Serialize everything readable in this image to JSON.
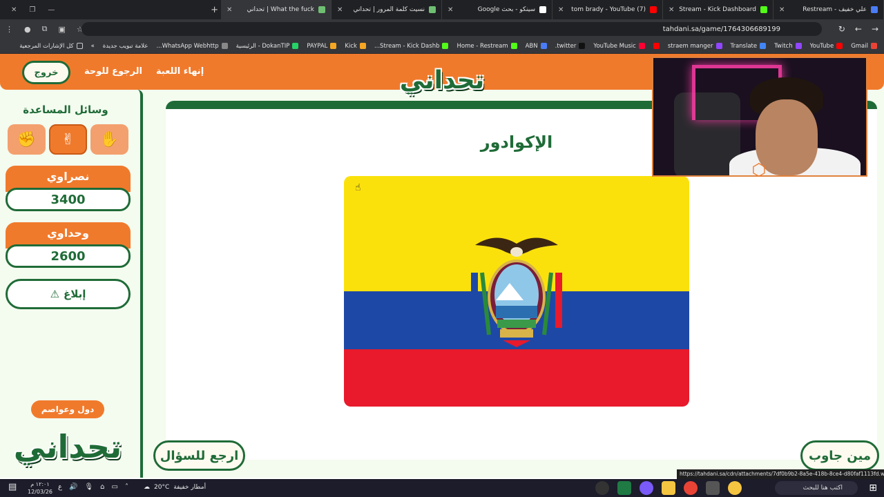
{
  "browser": {
    "tabs": [
      {
        "title": "علي خفيف - Restream",
        "color": "#4a7cf7"
      },
      {
        "title": "Stream - Kick Dashboard",
        "color": "#53fc18"
      },
      {
        "title": "(7) tom brady - YouTube",
        "color": "#ff0000"
      },
      {
        "title": "سينكو - بحث Google",
        "color": "#ffffff"
      },
      {
        "title": "نسيت كلمة المرور | تحداني",
        "color": "#6fbf73"
      },
      {
        "title": "What the fuck | تحداني",
        "color": "#6fbf73",
        "active": true
      }
    ],
    "url": "tahdani.sa/game/1764306689199",
    "bookmarks": [
      {
        "label": "Gmail",
        "color": "#ea4335"
      },
      {
        "label": "YouTube",
        "color": "#ff0000"
      },
      {
        "label": "Twitch",
        "color": "#9146ff"
      },
      {
        "label": "Translate",
        "color": "#4285f4"
      },
      {
        "label": "straem manger",
        "color": "#9146ff"
      },
      {
        "label": "",
        "color": "#ff0000"
      },
      {
        "label": "YouTube Music",
        "color": "#ff0033"
      },
      {
        "label": "twitter.",
        "color": "#111111"
      },
      {
        "label": "ABN",
        "color": "#4a7cf7"
      },
      {
        "label": "Home - Restream",
        "color": "#53fc18"
      },
      {
        "label": "Stream - Kick Dashb...",
        "color": "#53fc18"
      },
      {
        "label": "Kick",
        "color": "#f5a623"
      },
      {
        "label": "PAYPAL",
        "color": "#f5a623"
      },
      {
        "label": "DokanTIP - الرئيسية",
        "color": "#25d366"
      },
      {
        "label": "WhatsApp Webhttp...",
        "color": "#888888"
      },
      {
        "label": "علامة تبويب جديدة",
        "color": "#35363a"
      }
    ],
    "bookmarks_folder": "كل الإشارات المرجعية",
    "status_url": "https://tahdani.sa/cdn/attachments/7df0b9b2-8a5e-418b-8ce4-d80faf1113fd.webp"
  },
  "game": {
    "logo": "تحداني",
    "exit_label": "خروج",
    "back_to_board": "الرجوع للوحة",
    "end_game": "إنهاء اللعبة",
    "help_title": "وسائل المساعدة",
    "help_icons": [
      "fist-icon",
      "peace-hand-icon",
      "handshake-icon"
    ],
    "teams": [
      {
        "name": "نصراوي",
        "score": "3400"
      },
      {
        "name": "وحداوي",
        "score": "2600"
      }
    ],
    "report_label": "إبلاغ",
    "report_icon": "⚠",
    "category": "دول وعواصم",
    "answer": "الإكوادور",
    "back_to_question": "ارجع للسؤال",
    "who_answered": "مين جاوب"
  },
  "taskbar": {
    "search_placeholder": "اكتب هنا للبحث",
    "weather": "أمطار خفيفة",
    "temperature": "20°C",
    "time": "١٢:٠١ م",
    "date": "12/03/26"
  },
  "colors": {
    "brand_orange": "#f07a2c",
    "brand_green": "#1f6b37",
    "flag_yellow": "#fbe10c",
    "flag_blue": "#1e48a6",
    "flag_red": "#e81a2c"
  }
}
